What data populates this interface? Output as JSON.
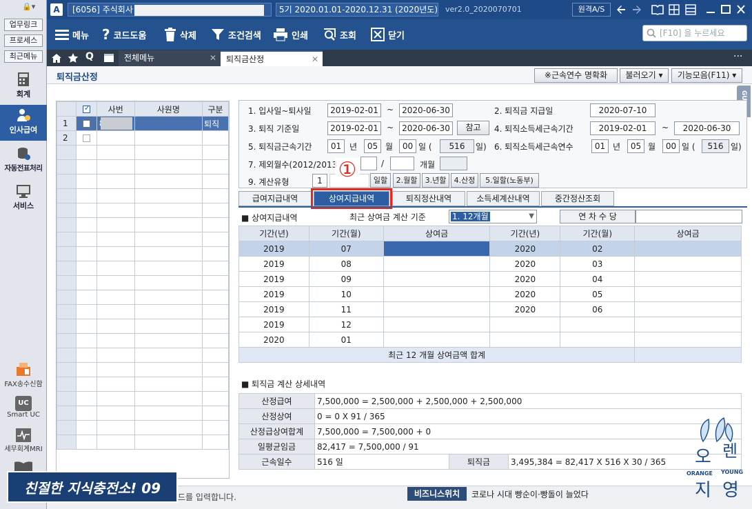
{
  "titlebar": {
    "company": "[6056] 주식회사",
    "period": "5기 2020.01.01-2020.12.31 (2020년도)",
    "version": "ver2.0_20200707​01",
    "remote_as": "원격A/S"
  },
  "toolbar": {
    "menu": "메뉴",
    "code_help": "코드도움",
    "delete": "삭제",
    "filter": "조건검색",
    "print": "인쇄",
    "view": "조회",
    "close": "닫기",
    "search_placeholder": "[F10] 을 누르세요"
  },
  "sidebar": {
    "top_buttons": [
      "업무링크",
      "프로세스",
      "최근메뉴"
    ],
    "items": [
      "회계",
      "인사급여",
      "자동전표처리",
      "서비스"
    ],
    "bottom_items": [
      "FAX송수신함",
      "Smart UC",
      "세무회계MRI"
    ],
    "uc_badge": "UC"
  },
  "tabs": [
    "전체메뉴",
    "퇴직금산정"
  ],
  "page": {
    "title": "퇴직금산정",
    "btn_confirm": "※근속연수 명확화",
    "btn_load": "불러오기",
    "btn_func": "기능모음(F11)",
    "guide": "GUIDE"
  },
  "emp_table": {
    "headers": [
      "사번",
      "사원명",
      "구분"
    ],
    "rows": [
      {
        "no": "1",
        "id": "8",
        "name": "",
        "type": "퇴직"
      },
      {
        "no": "2",
        "id": "",
        "name": "",
        "type": ""
      }
    ]
  },
  "form": {
    "l1": "1.  입사일~퇴사일",
    "hire": "2019-02-01",
    "tilde": "~",
    "leave": "2020-06-30",
    "l2": "2.  퇴직금 지급일",
    "paydate": "2020-07-10",
    "l3": "3.  퇴직 기준일",
    "base_from": "2019-02-01",
    "base_to": "2020-06-30",
    "ref": "참고",
    "l4": "4.  퇴직소득세근속기간",
    "tax_from": "2019-02-01",
    "tax_to": "2020-06-30",
    "l5": "5.  퇴직금근속기간",
    "y5": "01",
    "yu": "년",
    "m5": "05",
    "mu": "월",
    "d5": "00",
    "du": "일  (",
    "days5": "516",
    "dclose": "일)",
    "l6": "6.  퇴직소득세근속연수",
    "y6": "01",
    "m6": "05",
    "d6": "00",
    "days6": "516",
    "l7": "7.  제외월수(2012/2013",
    "slash": "/",
    "months": "개월",
    "l9": "9.  계산유형",
    "calc_val": "1",
    "calc_opts": [
      "일할",
      "2.월할",
      "3.년할",
      "4.산정",
      "5.일할(노동부)"
    ],
    "circle": "①"
  },
  "subtabs": [
    "급여지급내역",
    "상여지급내역",
    "퇴직정산내역",
    "소득세계산내역",
    "중간정산조회"
  ],
  "bonus": {
    "section": "■ 상여지급내역",
    "basis_label": "최근 상여금 계산 기준",
    "basis_value": "1. 12개월",
    "annual_label": "연 차 수 당",
    "headers": [
      "기간(년)",
      "기간(월)",
      "상여금",
      "기간(년)",
      "기간(월)",
      "상여금"
    ],
    "left_rows": [
      [
        "2019",
        "07"
      ],
      [
        "2019",
        "08"
      ],
      [
        "2019",
        "09"
      ],
      [
        "2019",
        "10"
      ],
      [
        "2019",
        "11"
      ],
      [
        "2019",
        "12"
      ],
      [
        "2020",
        "01"
      ]
    ],
    "right_rows": [
      [
        "2020",
        "02"
      ],
      [
        "2020",
        "03"
      ],
      [
        "2020",
        "04"
      ],
      [
        "2020",
        "05"
      ],
      [
        "2020",
        "06"
      ]
    ],
    "total_label": "최근 12 개월 상여금액 합계"
  },
  "detail": {
    "section": "■ 퇴직금 계산 상세내역",
    "rows": [
      {
        "label": "산정급여",
        "value": "7,500,000 = 2,500,000 + 2,500,000 + 2,500,000"
      },
      {
        "label": "산정상여",
        "value": "0 = 0 X 91 / 365"
      },
      {
        "label": "산정급상여합계",
        "value": "7,500,000 = 7,500,000 + 0"
      },
      {
        "label": "일평균임금",
        "value": "82,417 = 7,500,000 / 91"
      }
    ],
    "service_label": "근속일수",
    "service_value": "516 일",
    "severance_label": "퇴직금",
    "severance_value": "3,495,384 = 82,417 X 516 X 30 / 365"
  },
  "footer": {
    "hint": "드를 입력합니다.",
    "news_label": "비즈니스위치",
    "news": "코로나 시대 빵순이·빵돌이 늘었다",
    "banner": "친절한 지식충전소! 09"
  },
  "logo": {
    "line1": "오",
    "line2": "렌",
    "line3": "지",
    "line4": "영",
    "eng1": "ORANGE",
    "eng2": "YOUNG"
  }
}
